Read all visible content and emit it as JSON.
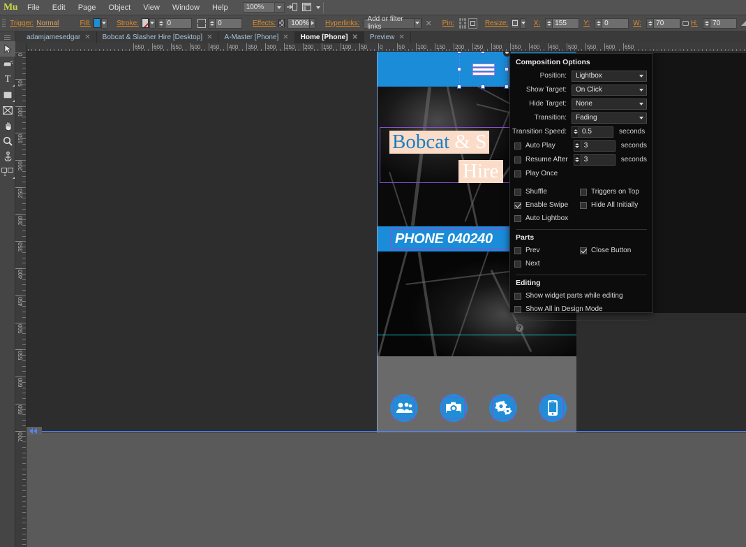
{
  "app": {
    "logo": "Mu"
  },
  "menubar": {
    "items": [
      "File",
      "Edit",
      "Page",
      "Object",
      "View",
      "Window",
      "Help"
    ],
    "zoom_value": "100%",
    "icons": [
      "preview-page-icon",
      "browser-fill-icon"
    ]
  },
  "controlbar": {
    "trigger_label": "Trigger:",
    "trigger_value": "Normal",
    "fill_label": "Fill:",
    "fill_color": "#1d8fd4",
    "stroke_label": "Stroke:",
    "stroke_width": "0",
    "corner_radius": "0",
    "effects_label": "Effects:",
    "effects_opacity": "100%",
    "hyperlinks_label": "Hyperlinks:",
    "hyperlinks_value": "Add or filter links",
    "pin_label": "Pin:",
    "resize_label": "Resize:",
    "x_label": "X:",
    "x_value": "155",
    "y_label": "Y:",
    "y_value": "0",
    "w_label": "W:",
    "w_value": "70",
    "h_label": "H:",
    "h_value": "70"
  },
  "tabs": [
    {
      "label": "adamjamesedgar",
      "active": false
    },
    {
      "label": "Bobcat & Slasher Hire [Desktop]",
      "active": false
    },
    {
      "label": "A-Master [Phone]",
      "active": false
    },
    {
      "label": "Home [Phone]",
      "active": true
    },
    {
      "label": "Preview",
      "active": false
    }
  ],
  "toolbox": [
    {
      "name": "selection-tool",
      "glyph": "selection",
      "selected": true
    },
    {
      "name": "crop-tool",
      "glyph": "crop",
      "selected": false
    },
    {
      "name": "text-tool",
      "glyph": "T",
      "selected": false
    },
    {
      "name": "rectangle-tool",
      "glyph": "rect",
      "selected": false
    },
    {
      "name": "image-tool",
      "glyph": "image",
      "selected": false
    },
    {
      "name": "hand-tool",
      "glyph": "hand",
      "selected": false
    },
    {
      "name": "zoom-tool",
      "glyph": "zoom",
      "selected": false
    },
    {
      "name": "anchor-tool",
      "glyph": "anchor",
      "selected": false
    },
    {
      "name": "widget-tool",
      "glyph": "widget",
      "selected": false
    }
  ],
  "rulers": {
    "horizontal": [
      "650",
      "600",
      "550",
      "500",
      "450",
      "400",
      "350",
      "300",
      "250",
      "200",
      "150",
      "100",
      "50",
      "0",
      "50",
      "100",
      "150",
      "200",
      "250",
      "300",
      "350",
      "400",
      "450",
      "500",
      "550",
      "600",
      "650"
    ],
    "vertical": [
      "0",
      "50",
      "100",
      "150",
      "200",
      "250",
      "300",
      "350",
      "400",
      "450",
      "500",
      "550",
      "600",
      "650",
      "700"
    ]
  },
  "canvas": {
    "page_header_color": "#1a8cd8",
    "title_line1_a": "Bobcat",
    "title_line1_b": " & S",
    "title_line2": "Hire",
    "phone_banner_text": "PHONE 040240",
    "hamburger_icon": "hamburger-menu-icon",
    "plus_badge": "+",
    "footer_icons": [
      {
        "name": "people-icon",
        "glyph": "people"
      },
      {
        "name": "camera-icon",
        "glyph": "camera"
      },
      {
        "name": "gears-icon",
        "glyph": "gears"
      },
      {
        "name": "mobile-icon",
        "glyph": "mobile"
      }
    ]
  },
  "panel": {
    "title": "Composition Options",
    "selects": [
      {
        "label": "Position:",
        "value": "Lightbox"
      },
      {
        "label": "Show Target:",
        "value": "On Click"
      },
      {
        "label": "Hide Target:",
        "value": "None"
      },
      {
        "label": "Transition:",
        "value": "Fading"
      }
    ],
    "spins": [
      {
        "label": "Transition Speed:",
        "value": "0.5",
        "unit": "seconds"
      }
    ],
    "timed": [
      {
        "label": "Auto Play",
        "checked": false,
        "value": "3",
        "unit": "seconds"
      },
      {
        "label": "Resume After",
        "checked": false,
        "value": "3",
        "unit": "seconds"
      }
    ],
    "play_once": {
      "label": "Play Once",
      "checked": false
    },
    "toggles": [
      {
        "label": "Shuffle",
        "checked": false,
        "label2": "Triggers on Top",
        "checked2": false
      },
      {
        "label": "Enable Swipe",
        "checked": true,
        "label2": "Hide All Initially",
        "checked2": false
      }
    ],
    "auto_lightbox": {
      "label": "Auto Lightbox",
      "checked": false
    },
    "parts_title": "Parts",
    "parts": [
      {
        "label": "Prev",
        "checked": false,
        "label2": "Close Button",
        "checked2": true
      },
      {
        "label": "Next",
        "checked": false,
        "label2": "",
        "checked2": null
      }
    ],
    "editing_title": "Editing",
    "editing": [
      {
        "label": "Show widget parts while editing",
        "checked": false
      },
      {
        "label": "Show All in Design Mode",
        "checked": false
      }
    ],
    "help": "?"
  }
}
